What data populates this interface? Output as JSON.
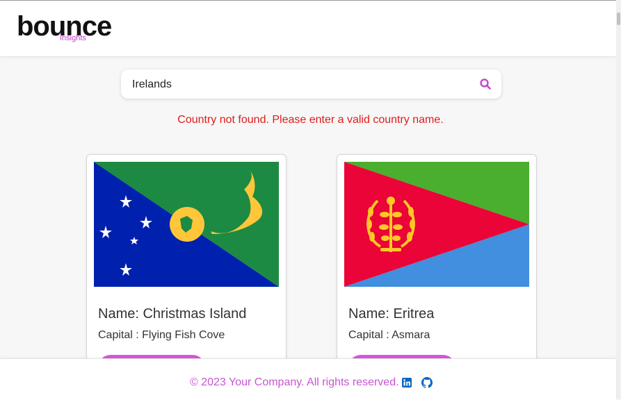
{
  "brand": {
    "logo_word": "bounce",
    "logo_sub": "Insights",
    "accent_color": "#d658dd"
  },
  "search": {
    "value": "Irelands",
    "icon": "search-icon"
  },
  "error": {
    "message": "Country not found. Please enter a valid country name.",
    "color": "#e01b1b"
  },
  "cards": [
    {
      "name": "Name: Christmas Island",
      "capital": "Capital : Flying Fish Cove",
      "flag": "christmas-island-flag"
    },
    {
      "name": "Name: Eritrea",
      "capital": "Capital : Asmara",
      "flag": "eritrea-flag"
    }
  ],
  "footer": {
    "copyright": "© 2023 Your Company. All rights reserved.",
    "icons": [
      "linkedin-icon",
      "github-icon"
    ]
  }
}
